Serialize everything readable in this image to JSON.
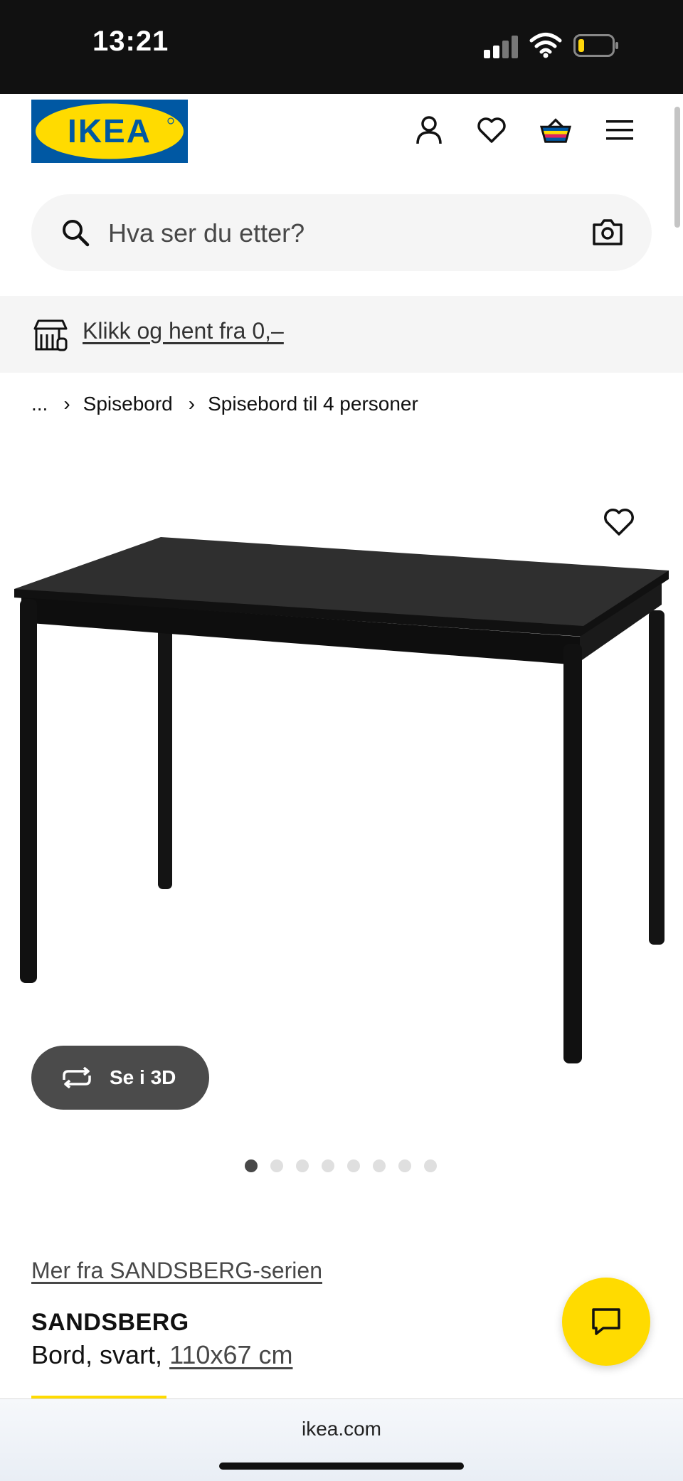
{
  "status_bar": {
    "time": "13:21"
  },
  "header": {
    "logo_text": "IKEA",
    "icons": [
      "account-icon",
      "heart-icon",
      "cart-icon",
      "menu-icon"
    ]
  },
  "search": {
    "placeholder": "Hva ser du etter?"
  },
  "promo": {
    "link_text": "Klikk og hent fra 0,–"
  },
  "breadcrumb": {
    "items": [
      "...",
      "Spisebord",
      "Spisebord til 4 personer"
    ]
  },
  "gallery": {
    "view_3d_label": "Se i 3D",
    "image_count": 8,
    "active_index": 0
  },
  "product": {
    "series_link": "Mer fra SANDSBERG-serien",
    "name": "SANDSBERG",
    "description": "Bord, svart, ",
    "size": "110x67 cm"
  },
  "browser": {
    "url": "ikea.com"
  },
  "colors": {
    "ikea_blue": "#0058a3",
    "ikea_yellow": "#ffdb00",
    "button_dark": "#4b4b4b"
  }
}
